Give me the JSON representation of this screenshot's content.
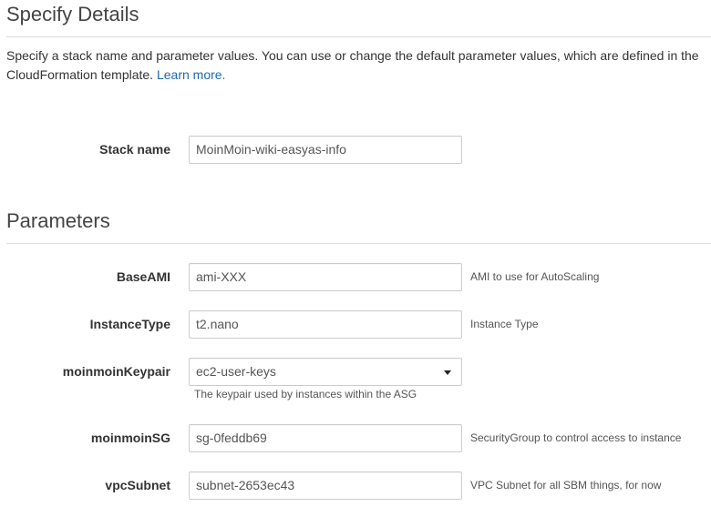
{
  "details": {
    "title": "Specify Details",
    "description_line1": "Specify a stack name and parameter values. You can use or change the default parameter values, which are defined in the",
    "description_line2": "CloudFormation template.",
    "learn_more": "Learn more."
  },
  "stack": {
    "label": "Stack name",
    "value": "MoinMoin-wiki-easyas-info"
  },
  "parameters": {
    "title": "Parameters",
    "base_ami": {
      "label": "BaseAMI",
      "value": "ami-XXX",
      "hint": "AMI to use for AutoScaling"
    },
    "instance_type": {
      "label": "InstanceType",
      "value": "t2.nano",
      "hint": "Instance Type"
    },
    "keypair": {
      "label": "moinmoinKeypair",
      "value": "ec2-user-keys",
      "hint": "The keypair used by instances within the ASG"
    },
    "sg": {
      "label": "moinmoinSG",
      "value": "sg-0feddb69",
      "hint": "SecurityGroup to control access to instance"
    },
    "subnet": {
      "label": "vpcSubnet",
      "value": "subnet-2653ec43",
      "hint": "VPC Subnet for all SBM things, for now"
    }
  },
  "colors": {
    "link": "#1f66b3",
    "border": "#cccccc",
    "rule": "#dddddd"
  },
  "icons": {
    "dropdown": "caret-down-icon"
  }
}
